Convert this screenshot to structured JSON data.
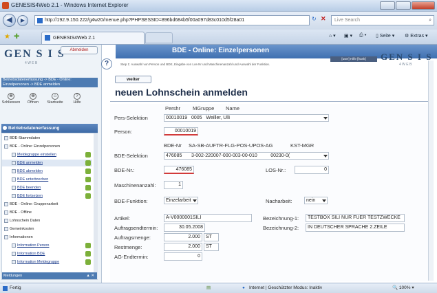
{
  "window": {
    "title": "GENESIS4Web 2.1 - Windows Internet Explorer"
  },
  "browser": {
    "url": "http://192.9.150.222/g4w20/menue.php?PHPSESSID=896bd684b5f00a097d83c010d5f28a01",
    "search_placeholder": "Live Search",
    "tab_label": "GENESIS4Web 2.1",
    "toolbar": {
      "page": "Seite",
      "tools": "Extras"
    }
  },
  "left": {
    "logo": "GEN S I S",
    "logo_sub": "4 W E B",
    "anmelden": "Abmelden",
    "topbar_text": "Betriebsdatenerfassung -> BDE - Online: Einzelpersonen -> BDE anmelden",
    "icons": [
      {
        "label": "Schliessen",
        "glyph": "⊗"
      },
      {
        "label": "Öffnen",
        "glyph": "⊕"
      },
      {
        "label": "Startseite",
        "glyph": "⌂"
      },
      {
        "label": "Hilfe",
        "glyph": "?"
      }
    ],
    "section_header": "Betriebsdatenerfassung",
    "nav": [
      {
        "label": "BDE-Stammdaten",
        "indent": 1,
        "link": false,
        "check": false
      },
      {
        "label": "BDE - Online: Einzelpersonen",
        "indent": 1,
        "link": false,
        "check": false
      },
      {
        "label": "Meldegruppe einstellen",
        "indent": 2,
        "link": true,
        "check": true
      },
      {
        "label": "BDE anmelden",
        "indent": 2,
        "link": true,
        "check": true,
        "selected": true
      },
      {
        "label": "BDE abmelden",
        "indent": 2,
        "link": true,
        "check": true
      },
      {
        "label": "BDE unterbrechen",
        "indent": 2,
        "link": true,
        "check": true
      },
      {
        "label": "BDE beenden",
        "indent": 2,
        "link": true,
        "check": true
      },
      {
        "label": "BDE fortsetzen",
        "indent": 2,
        "link": true,
        "check": true
      },
      {
        "label": "BDE - Online: Gruppenarbeit",
        "indent": 1,
        "link": false,
        "check": false
      },
      {
        "label": "BDE - Offline",
        "indent": 1,
        "link": false,
        "check": false
      },
      {
        "label": "Lohnschein Daten",
        "indent": 1,
        "link": false,
        "check": false
      },
      {
        "label": "Gemeinkosten",
        "indent": 1,
        "link": false,
        "check": false
      },
      {
        "label": "Informationen",
        "indent": 1,
        "link": false,
        "check": false
      },
      {
        "label": "Information Person",
        "indent": 2,
        "link": true,
        "check": true
      },
      {
        "label": "Information BDE",
        "indent": 2,
        "link": true,
        "check": true
      },
      {
        "label": "Information Meldegruppe",
        "indent": 2,
        "link": true,
        "check": true
      }
    ],
    "bottom_bar": "Meldungen"
  },
  "header": {
    "title": "BDE - Online:  Einzelpersonen",
    "right_box": "[user] Hilfe [frank]",
    "logo": "GEN S I S",
    "logo_sub": "4 W E B",
    "hint": "Step 1: Auswahl von Person und BDE, Eingabe von Los-Nr und Maschinenanzahl und Auswahl der Funktion."
  },
  "form": {
    "weiter": "weiter",
    "title": "neuen Lohnschein anmelden",
    "pers_header": {
      "c1": "Pershr",
      "c2": "MGruppe",
      "c3": "Name"
    },
    "pers_selektion_label": "Pers-Selektion",
    "pers_selektion": {
      "persnr": "00010019",
      "mgruppe": "0005",
      "name": "Weiller, Ulli"
    },
    "person_label": "Person:",
    "person_value": "00010019",
    "bde_header": {
      "c1": "BDE-Nr",
      "c2": "SA-SB-AUFTR-FLG-POS-UPOS-AG",
      "c3": "KST-MGR"
    },
    "bde_selektion_label": "BDE-Selektion",
    "bde_selektion": {
      "bdenr": "476085",
      "auftr": "3-002-220007-000-003-00-010",
      "kst": "00230-0("
    },
    "bde_nr_label": "BDE-Nr.:",
    "bde_nr_value": "476085",
    "los_nr_label": "LOS-Nr.:",
    "los_nr_value": "0",
    "maschinen_label": "Maschinenanzahl:",
    "maschinen_value": "1",
    "funktion_label": "BDE-Funktion:",
    "funktion_value": "Einzelarbeit",
    "nacharbeit_label": "Nacharbeit:",
    "nacharbeit_value": "nein",
    "artikel_label": "Artikel:",
    "artikel_value": "A-V0000001SILI",
    "termin_label": "Auftragsendtermin:",
    "termin_value": "30.05.2008",
    "menge_label": "Auftragsmenge:",
    "menge_value": "2.000",
    "menge_unit": "ST",
    "rest_label": "Restmenge:",
    "rest_value": "2.000",
    "rest_unit": "ST",
    "ag_label": "AG-Endtermin:",
    "ag_value": "0",
    "bez1_label": "Bezeichnung-1:",
    "bez1_value": "TESTBOX SILI NUR FUER TESTZWECKE",
    "bez2_label": "Bezeichnung-2:",
    "bez2_value": "IN DEUTSCHER SPRACHE 2.ZEILE"
  },
  "status": {
    "left": "Fertig",
    "zone": "Internet | Geschützter Modus: Inaktiv",
    "zoom": "100%"
  }
}
